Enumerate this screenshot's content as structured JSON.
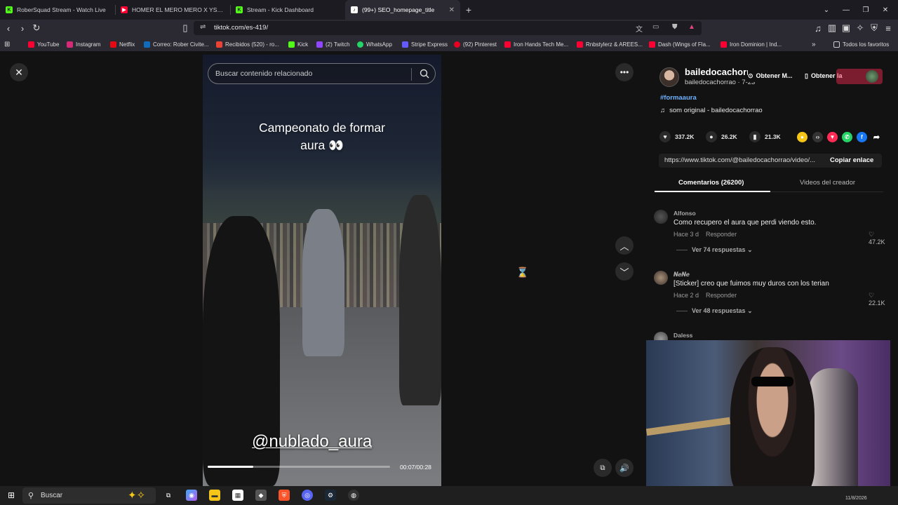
{
  "browser": {
    "tabs": [
      {
        "title": "RoberSquad Stream - Watch Live",
        "favicon": "kick-icon",
        "color": "#53fc18",
        "active": false
      },
      {
        "title": "HOMER EL MERO MERO X YSY A - D",
        "favicon": "youtube-icon",
        "color": "#ff0033",
        "active": false
      },
      {
        "title": "Stream - Kick Dashboard",
        "favicon": "kick-icon",
        "color": "#53fc18",
        "active": false
      },
      {
        "title": "(99+) SEO_homepage_title",
        "favicon": "tiktok-icon",
        "color": "#ffffff",
        "active": true
      }
    ],
    "url": "tiktok.com/es-419/",
    "bookmarks": [
      {
        "label": "YouTube",
        "color": "#ff0033"
      },
      {
        "label": "Instagram",
        "color": "#d62976"
      },
      {
        "label": "Netflix",
        "color": "#e50914"
      },
      {
        "label": "Correo: Rober Civite...",
        "color": "#0f6cbd"
      },
      {
        "label": "Recibidos (520) - ro...",
        "color": "#ea4335"
      },
      {
        "label": "Kick",
        "color": "#53fc18"
      },
      {
        "label": "(2) Twitch",
        "color": "#9146ff"
      },
      {
        "label": "WhatsApp",
        "color": "#25d366"
      },
      {
        "label": "Stripe Express",
        "color": "#635bff"
      },
      {
        "label": "(92) Pinterest",
        "color": "#e60023"
      },
      {
        "label": "Iron Hands Tech Me...",
        "color": "#ff0033"
      },
      {
        "label": "Rnbstylerz & AREES...",
        "color": "#ff0033"
      },
      {
        "label": "Dash (Wings of Fla...",
        "color": "#ff0033"
      },
      {
        "label": "Iron Dominion | Ind...",
        "color": "#ff0033"
      }
    ],
    "bookmarks_folder": "Todos los favoritos"
  },
  "video": {
    "search_placeholder": "Buscar contenido relacionado",
    "caption_line1": "Campeonato de formar",
    "caption_line2": "aura 👀",
    "watermark": "@nublado_aura",
    "timecode": "00:07/00:28",
    "progress": 0.25
  },
  "panel": {
    "username": "bailedocachorrao",
    "handle": "bailedocachorrao · 7-23",
    "get_app_label": "Obtener M...",
    "get_app2_label": "Obtener la",
    "hashtag": "#formaaura",
    "sound": "som original - bailedocachorrao",
    "likes": "337.2K",
    "comments_count": "26.2K",
    "saves": "21.3K",
    "link": "https://www.tiktok.com/@bailedocachorrao/video/...",
    "copy_label": "Copiar enlace",
    "tab_comments": "Comentarios (26200)",
    "tab_videos": "Videos del creador",
    "comments": [
      {
        "user": "Alfonso",
        "text": "Como recupero el aura que perdi viendo esto.",
        "time": "Hace 3 d",
        "reply": "Responder",
        "likes": "47.2K",
        "more": "Ver 74 respuestas"
      },
      {
        "user": "𝑵𝒆𝑵𝒆",
        "text": "[Sticker] creo que fuimos muy duros con los terian",
        "time": "Hace 2 d",
        "reply": "Responder",
        "likes": "22.1K",
        "more": "Ver 48 respuestas"
      },
      {
        "user": "Daless",
        "text": "",
        "time": "",
        "reply": "",
        "likes": "",
        "more": ""
      }
    ]
  },
  "taskbar": {
    "search_placeholder": "Buscar",
    "date": "11/8/2026"
  }
}
